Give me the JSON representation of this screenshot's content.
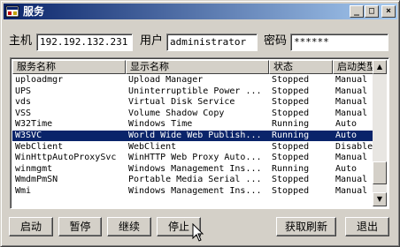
{
  "window": {
    "title": "服务",
    "minimize_glyph": "_",
    "maximize_glyph": "□",
    "close_glyph": "×"
  },
  "form": {
    "host_label": "主机",
    "host_value": "192.192.132.231",
    "user_label": "用户",
    "user_value": "administrator",
    "password_label": "密码",
    "password_value": "******"
  },
  "list": {
    "columns": [
      "服务名称",
      "显示名称",
      "状态",
      "启动类型"
    ],
    "rows": [
      {
        "name": "uploadmgr",
        "display": "Upload Manager",
        "status": "Stopped",
        "startup": "Manual"
      },
      {
        "name": "UPS",
        "display": "Uninterruptible Power ...",
        "status": "Stopped",
        "startup": "Manual"
      },
      {
        "name": "vds",
        "display": "Virtual Disk Service",
        "status": "Stopped",
        "startup": "Manual"
      },
      {
        "name": "VSS",
        "display": "Volume Shadow Copy",
        "status": "Stopped",
        "startup": "Manual"
      },
      {
        "name": "W32Time",
        "display": "Windows Time",
        "status": "Running",
        "startup": "Auto"
      },
      {
        "name": "W3SVC",
        "display": "World Wide Web Publish...",
        "status": "Running",
        "startup": "Auto"
      },
      {
        "name": "WebClient",
        "display": "WebClient",
        "status": "Stopped",
        "startup": "Disabled"
      },
      {
        "name": "WinHttpAutoProxySvc",
        "display": "WinHTTP Web Proxy Auto...",
        "status": "Stopped",
        "startup": "Manual"
      },
      {
        "name": "winmgmt",
        "display": "Windows Management Ins...",
        "status": "Running",
        "startup": "Auto"
      },
      {
        "name": "WmdmPmSN",
        "display": "Portable Media Serial ...",
        "status": "Stopped",
        "startup": "Manual"
      },
      {
        "name": "Wmi",
        "display": "Windows Management Ins...",
        "status": "Stopped",
        "startup": "Manual"
      }
    ],
    "selected_index": 5,
    "scroll_fraction": 0.9
  },
  "buttons": {
    "start": "启动",
    "pause": "暂停",
    "continue": "继续",
    "stop": "停止",
    "refresh": "获取刷新",
    "exit": "退出"
  },
  "scrollbar": {
    "up_glyph": "▲",
    "down_glyph": "▼"
  }
}
